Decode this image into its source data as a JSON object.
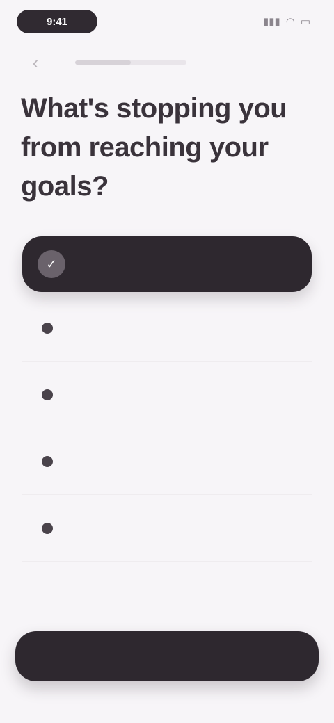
{
  "status_bar": {
    "time": "9:41",
    "signal_icon": "signal-icon",
    "wifi_icon": "wifi-icon",
    "battery_icon": "battery-icon"
  },
  "header": {
    "back_icon": "back-arrow-icon",
    "step_label": "",
    "progress": 0.5
  },
  "question": "What's stopping you from reaching your goals?",
  "options": {
    "selected": {
      "label": ""
    },
    "items": [
      {
        "label": ""
      },
      {
        "label": ""
      },
      {
        "label": ""
      },
      {
        "label": ""
      }
    ]
  },
  "cta": {
    "label": ""
  },
  "colors": {
    "background": "#f7f5f8",
    "primary_dark": "#2e282f",
    "text": "#3a333b"
  }
}
